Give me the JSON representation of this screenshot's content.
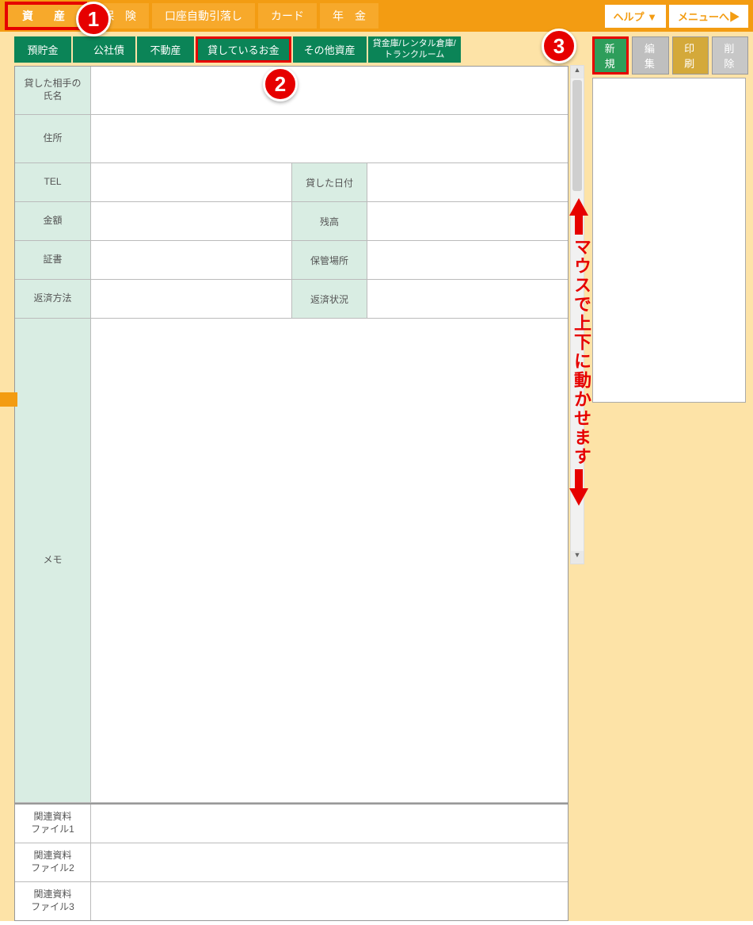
{
  "topnav": {
    "items": [
      "資　産",
      "保　険",
      "口座自動引落し",
      "カード",
      "年　金"
    ],
    "help": "ヘルプ ▼",
    "menu": "メニューへ▶"
  },
  "subtabs": [
    "預貯金",
    "公社債",
    "不動産",
    "貸しているお金",
    "その他資産",
    "貸金庫/レンタル倉庫/\nトランクルーム"
  ],
  "actions": {
    "new": "新 規",
    "edit": "編 集",
    "print": "印 刷",
    "delete": "削 除"
  },
  "form": {
    "lender_name": "貸した相手の\n氏名",
    "address": "住所",
    "tel": "TEL",
    "lent_date": "貸した日付",
    "amount": "金額",
    "balance": "残高",
    "cert": "証書",
    "storage": "保管場所",
    "repay_method": "返済方法",
    "repay_status": "返済状況",
    "memo": "メモ",
    "file1": "関連資料\nファイル1",
    "file2": "関連資料\nファイル2",
    "file3": "関連資料\nファイル3"
  },
  "callouts": {
    "c1": "1",
    "c2": "2",
    "c3": "3"
  },
  "overlay": {
    "text": "マウスで上下に動かせます"
  }
}
